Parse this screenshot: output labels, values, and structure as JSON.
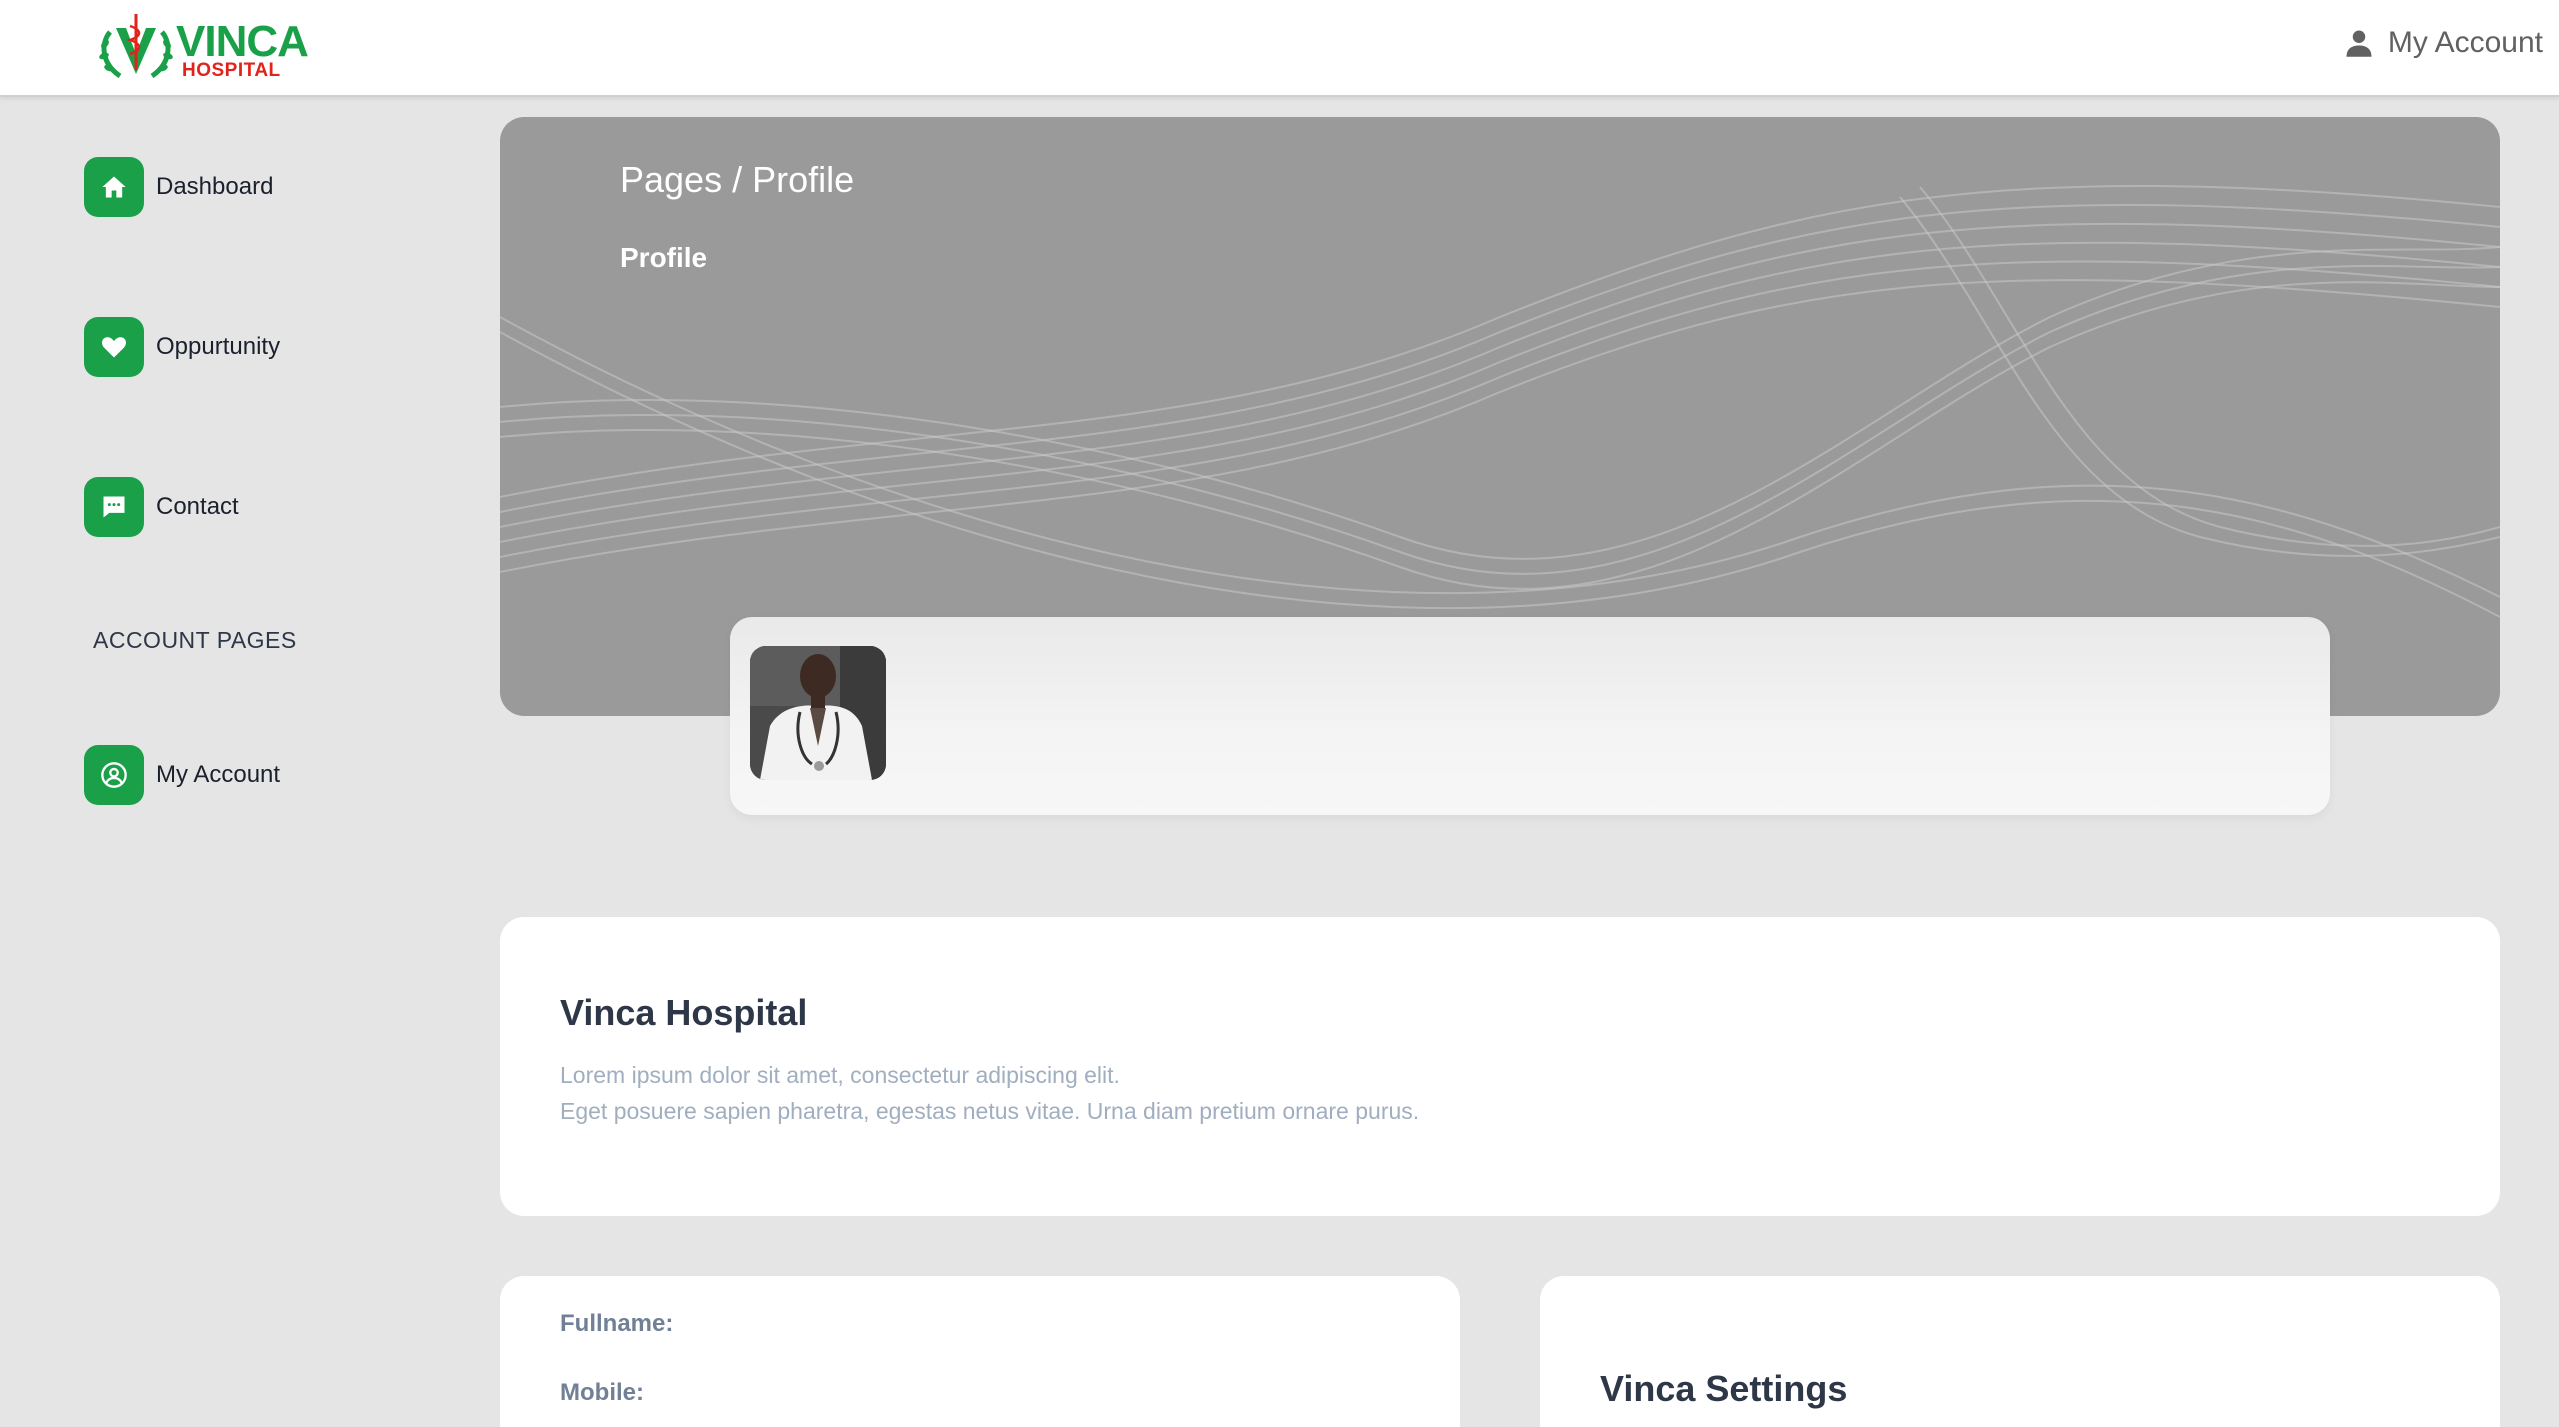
{
  "brand": {
    "name": "VINCA",
    "sub": "HOSPITAL",
    "primary_color": "#1aa049",
    "accent_color": "#e2231a"
  },
  "header": {
    "account_label": "My Account",
    "account_icon": "user-icon"
  },
  "sidebar": {
    "items": [
      {
        "label": "Dashboard",
        "icon": "home-icon"
      },
      {
        "label": "Oppurtunity",
        "icon": "heart-icon"
      },
      {
        "label": "Contact",
        "icon": "chat-icon"
      }
    ],
    "section_label": "ACCOUNT PAGES",
    "account_items": [
      {
        "label": "My Account",
        "icon": "user-circle-icon"
      }
    ]
  },
  "banner": {
    "breadcrumb": "Pages / Profile",
    "title": "Profile"
  },
  "about": {
    "title": "Vinca Hospital",
    "line1": "Lorem ipsum dolor sit amet, consectetur adipiscing elit.",
    "line2": "Eget posuere sapien pharetra, egestas netus vitae. Urna diam pretium ornare purus."
  },
  "info": {
    "fullname_label": "Fullname:",
    "mobile_label": "Mobile:"
  },
  "settings": {
    "title": "Vinca Settings"
  }
}
